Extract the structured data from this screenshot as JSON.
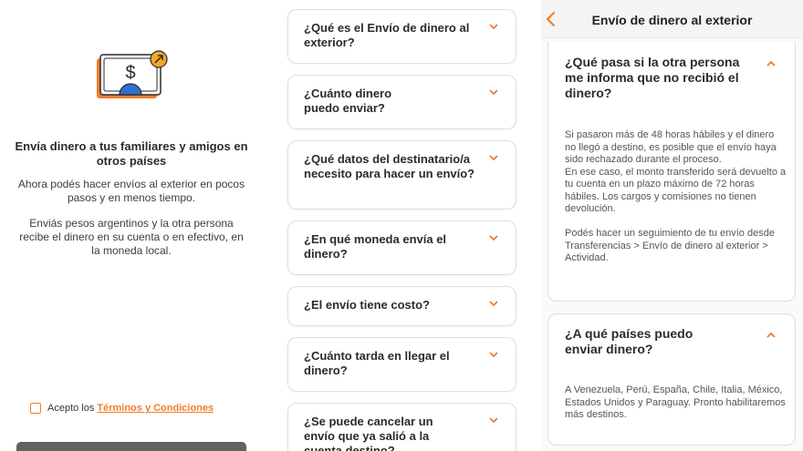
{
  "intro": {
    "title": "Envía dinero a tus familiares y amigos en otros países",
    "paragraph_1": "Ahora podés hacer envíos al exterior en pocos pasos y en menos tiempo.",
    "paragraph_2": "Enviás pesos argentinos y la otra persona recibe el dinero en su cuenta o en efectivo, en la moneda local.",
    "illustration_icon": "dollar-bill-send-icon",
    "terms_prefix": "Acepto los",
    "terms_link": "Términos y Condiciones",
    "checkbox_checked": false
  },
  "faq_list": {
    "items": [
      {
        "question": "¿Qué es el Envío de dinero al exterior?"
      },
      {
        "question": "¿Cuánto dinero puedo enviar?"
      },
      {
        "question": "¿Qué datos del destinatario/a necesito para hacer un envío?"
      },
      {
        "question": "¿En qué moneda envía el dinero?"
      },
      {
        "question": "¿El envío tiene costo?"
      },
      {
        "question": "¿Cuánto tarda en llegar el dinero?"
      },
      {
        "question": "¿Se puede cancelar un envío que ya salió a la cuenta destino?"
      }
    ]
  },
  "detail": {
    "header_title": "Envío de dinero al exterior",
    "back_icon": "chevron-left-icon",
    "cards": [
      {
        "question": "¿Qué pasa si la otra persona me informa que no recibió el dinero?",
        "answer_1": "Si pasaron más de 48 horas hábiles y el dinero no llegó a destino, es posible que el envío haya sido rechazado durante el proceso.",
        "answer_2": "En ese caso, el monto transferido será devuelto a tu cuenta en un plazo máximo de 72 horas hábiles. Los cargos y comisiones no tienen devolución.",
        "answer_3": "Podés hacer un seguimiento de tu envío desde Transferencias > Envío de dinero al exterior > Actividad."
      },
      {
        "question": "¿A qué países puedo enviar dinero?",
        "answer_1": "A Venezuela, Perú, España, Chile, Italia, México, Estados Unidos y Paraguay. Pronto habilitaremos más destinos."
      }
    ]
  },
  "colors": {
    "accent": "#f07d2a",
    "button_disabled": "#626262",
    "illustration_blue": "#2f6fd6"
  }
}
